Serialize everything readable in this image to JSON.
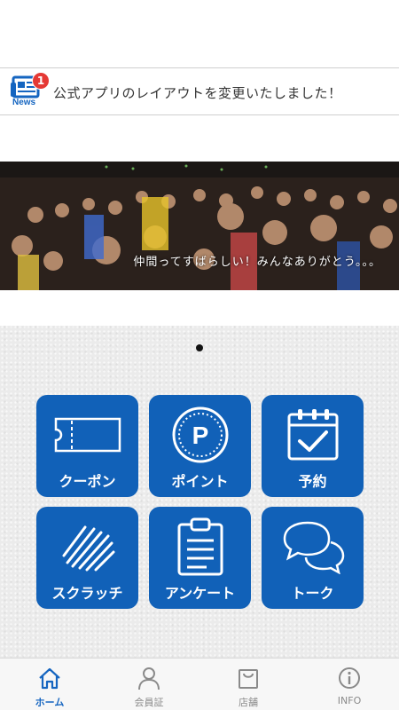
{
  "news": {
    "icon": "news-icon",
    "badge_count": "1",
    "label": "News",
    "message": "公式アプリのレイアウトを変更いたしました！"
  },
  "banner": {
    "caption": "仲間ってすばらしい！みんなありがとう。。。"
  },
  "carousel": {
    "page_count": 1,
    "active_index": 0
  },
  "menu": [
    {
      "label": "クーポン",
      "icon": "ticket-icon"
    },
    {
      "label": "ポイント",
      "icon": "point-icon"
    },
    {
      "label": "予約",
      "icon": "calendar-check-icon"
    },
    {
      "label": "スクラッチ",
      "icon": "scratch-icon"
    },
    {
      "label": "アンケート",
      "icon": "clipboard-icon"
    },
    {
      "label": "トーク",
      "icon": "chat-bubbles-icon"
    }
  ],
  "tabs": [
    {
      "label": "ホーム",
      "icon": "home-icon",
      "active": true
    },
    {
      "label": "会員証",
      "icon": "person-icon",
      "active": false
    },
    {
      "label": "店舗",
      "icon": "shop-bag-icon",
      "active": false
    },
    {
      "label": "INFO",
      "icon": "info-icon",
      "active": false
    }
  ],
  "colors": {
    "accent": "#1161b8",
    "badge": "#e53935",
    "tab_active": "#1565c0",
    "tab_inactive": "#8a8a8a"
  }
}
